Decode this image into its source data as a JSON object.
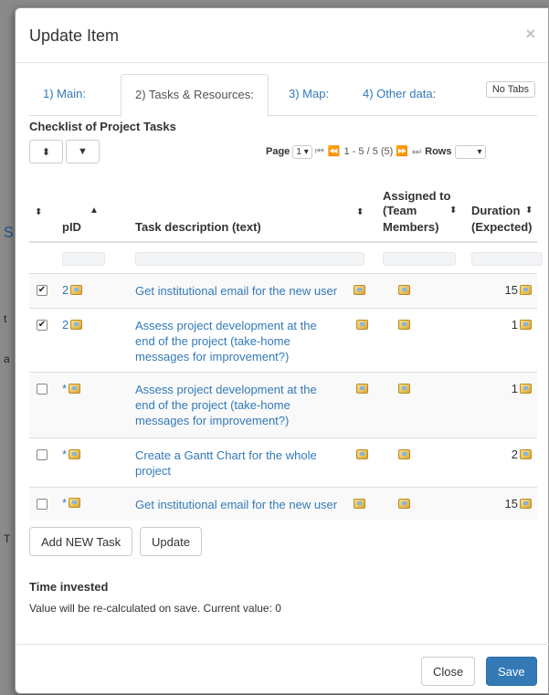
{
  "background": {
    "fragments": [
      "s",
      "t",
      "a",
      "T"
    ]
  },
  "modal": {
    "title": "Update Item",
    "close": "×"
  },
  "tabs": [
    {
      "label": "1) Main:"
    },
    {
      "label": "2) Tasks & Resources:"
    },
    {
      "label": "3) Map:"
    },
    {
      "label": "4) Other data:"
    }
  ],
  "no_tabs_label": "No Tabs",
  "checklist_title": "Checklist of Project Tasks",
  "pager": {
    "page_label": "Page",
    "page_value": "1",
    "range_text": "1 - 5 / 5 (5)",
    "rows_label": "Rows",
    "rows_value": ""
  },
  "table": {
    "headers": {
      "pid": "pID",
      "desc": "Task description (text)",
      "assigned_1": "Assigned to",
      "assigned_2": "(Team",
      "assigned_3": "Members)",
      "duration_1": "Duration",
      "duration_2": "(Expected)"
    },
    "rows": [
      {
        "checked": true,
        "pid": "2",
        "desc": "Get institutional email for the new user",
        "duration": "15"
      },
      {
        "checked": true,
        "pid": "2",
        "desc": "Assess project development at the end of the project (take-home messages for improvement?)",
        "duration": "1"
      },
      {
        "checked": false,
        "pid": "*",
        "desc": "Assess project development at the end of the project (take-home messages for improvement?)",
        "duration": "1"
      },
      {
        "checked": false,
        "pid": "*",
        "desc": "Create a Gantt Chart for the whole project",
        "duration": "2"
      },
      {
        "checked": false,
        "pid": "*",
        "desc": "Get institutional email for the new user",
        "duration": "15"
      }
    ]
  },
  "buttons": {
    "add_new_task": "Add NEW Task",
    "update": "Update",
    "close": "Close",
    "save": "Save"
  },
  "time_invested": {
    "title": "Time invested",
    "text": "Value will be re-calculated on save. Current value: 0"
  },
  "colors": {
    "link": "#337ab7",
    "primary": "#337ab7"
  }
}
